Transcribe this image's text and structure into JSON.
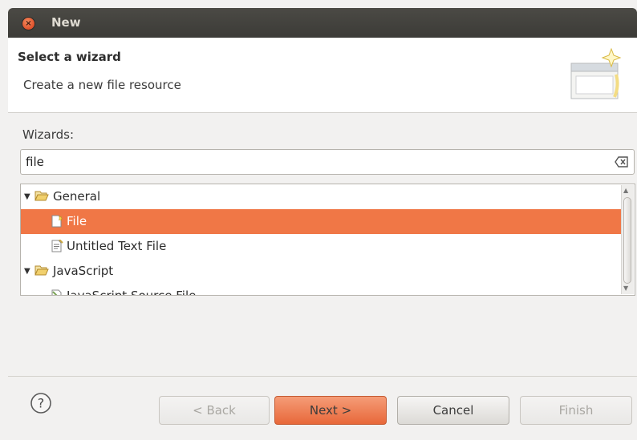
{
  "window": {
    "title": "New",
    "close_glyph": "×"
  },
  "header": {
    "title": "Select a wizard",
    "description": "Create a new file resource"
  },
  "wizards_label": "Wizards:",
  "filter": {
    "value": "file",
    "clear_icon": "clear-text-icon"
  },
  "tree": {
    "items": [
      {
        "label": "General",
        "icon": "folder-open-icon",
        "expanded": true,
        "level": 0,
        "selected": false
      },
      {
        "label": "File",
        "icon": "new-file-icon",
        "level": 1,
        "selected": true
      },
      {
        "label": "Untitled Text File",
        "icon": "text-file-icon",
        "level": 1,
        "selected": false
      },
      {
        "label": "JavaScript",
        "icon": "folder-open-icon",
        "expanded": true,
        "level": 0,
        "selected": false
      },
      {
        "label": "JavaScript Source File",
        "icon": "js-file-icon",
        "level": 1,
        "selected": false
      }
    ]
  },
  "buttons": {
    "back": "< Back",
    "next": "Next >",
    "cancel": "Cancel",
    "finish": "Finish",
    "help": "?"
  },
  "colors": {
    "selection": "#f07746",
    "titlebar": "#3c3b37",
    "primary_button": "#e8683a"
  }
}
